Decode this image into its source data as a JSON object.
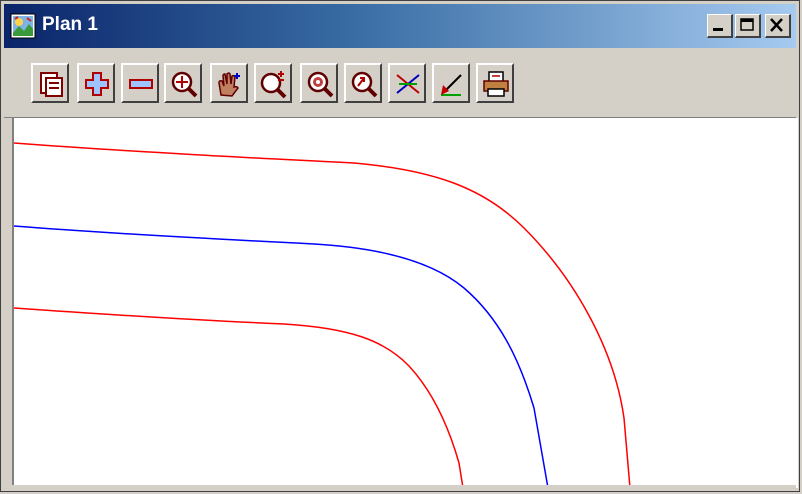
{
  "window": {
    "title": "Plan 1",
    "title_bar_colors": {
      "start": "#0a246a",
      "end": "#a6caf0"
    }
  },
  "caption_buttons": [
    {
      "name": "minimize-button",
      "icon": "minimize-icon"
    },
    {
      "name": "maximize-button",
      "icon": "maximize-icon"
    },
    {
      "name": "close-button",
      "icon": "close-icon"
    }
  ],
  "toolbar": {
    "buttons": [
      {
        "name": "plot-settings-button",
        "icon": "layers-panel-icon"
      },
      {
        "name": "zoom-in-button",
        "icon": "plus-icon"
      },
      {
        "name": "zoom-out-button",
        "icon": "minus-icon"
      },
      {
        "name": "zoom-extent-button",
        "icon": "zoom-magnifier-icon"
      },
      {
        "name": "pan-button",
        "icon": "hand-pan-icon"
      },
      {
        "name": "zoom-window-button",
        "icon": "zoom-plus-minus-icon"
      },
      {
        "name": "zoom-center-button",
        "icon": "zoom-target-icon"
      },
      {
        "name": "zoom-previous-button",
        "icon": "zoom-arrow-icon"
      },
      {
        "name": "clear-view-button",
        "icon": "cross-lines-icon"
      },
      {
        "name": "pick-element-button",
        "icon": "pick-arrow-icon"
      },
      {
        "name": "print-button",
        "icon": "printer-icon"
      }
    ]
  },
  "plan_view": {
    "lines": [
      {
        "name": "outer-edge-line",
        "color": "#ff0000"
      },
      {
        "name": "centreline",
        "color": "#0000ff"
      },
      {
        "name": "inner-edge-line",
        "color": "#ff0000"
      }
    ]
  }
}
